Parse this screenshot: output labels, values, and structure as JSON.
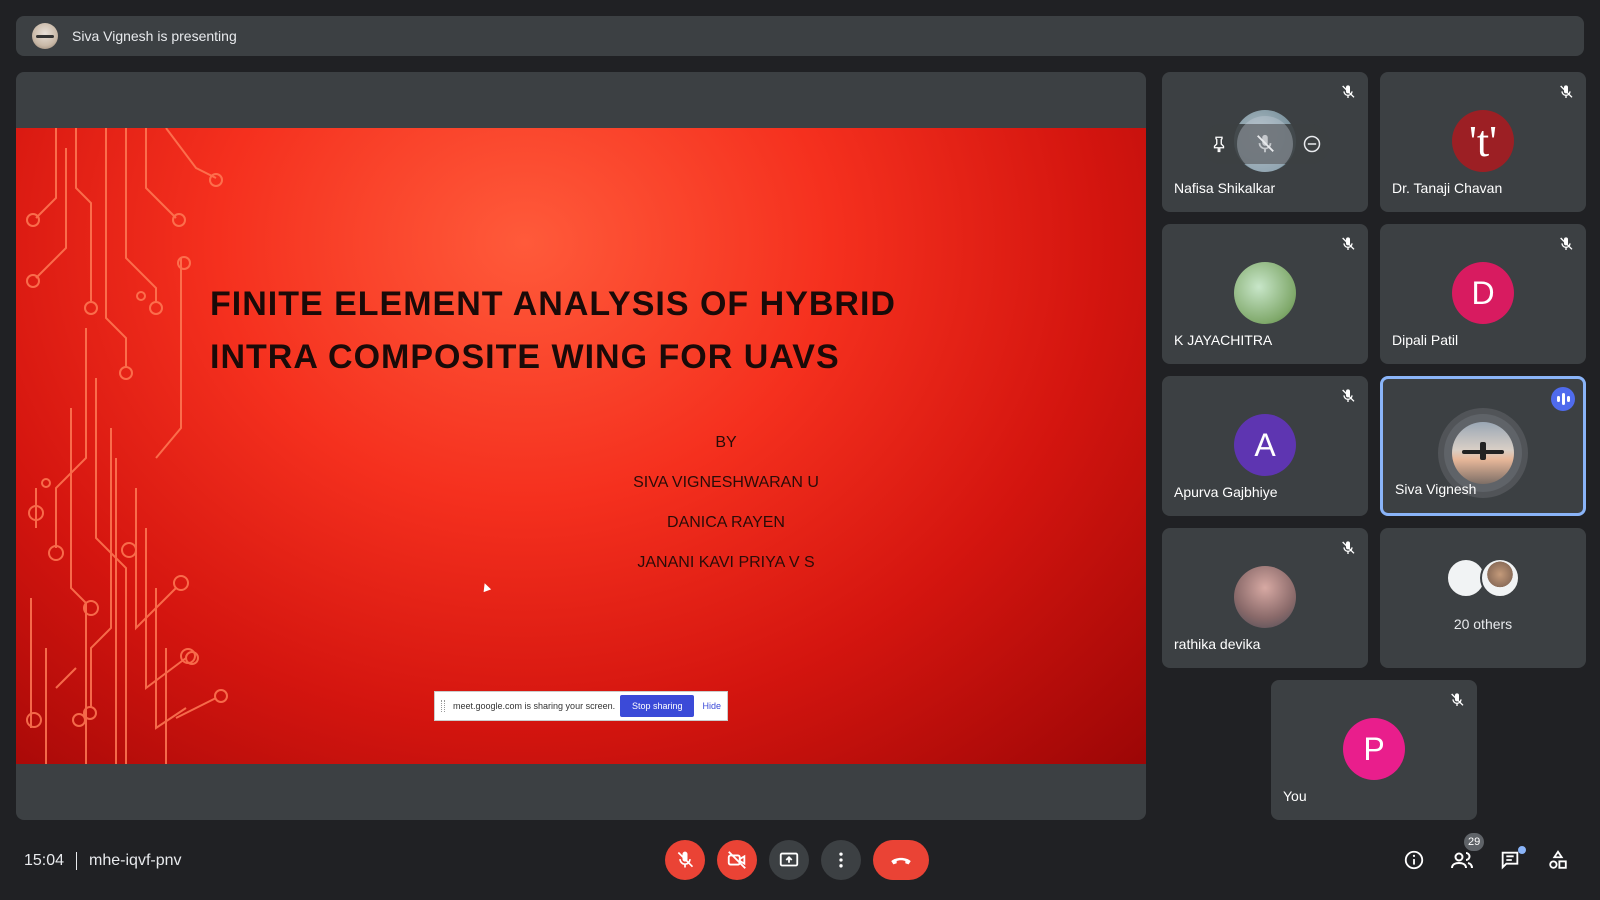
{
  "banner": {
    "presenter_text": "Siva Vignesh is presenting"
  },
  "slide": {
    "title_line1": "FINITE ELEMENT ANALYSIS OF HYBRID",
    "title_line2": "INTRA COMPOSITE WING FOR UAVS",
    "by": "BY",
    "authors": [
      "SIVA VIGNESHWARAN U",
      "DANICA RAYEN",
      "JANANI KAVI PRIYA V S"
    ],
    "share_notice": "meet.google.com is sharing your screen.",
    "stop_sharing": "Stop sharing",
    "hide": "Hide"
  },
  "participants": [
    {
      "name": "Nafisa Shikalkar",
      "avatar": "photo",
      "muted": true
    },
    {
      "name": "Dr. Tanaji Chavan",
      "initial": "'t'",
      "color": "#9c1f24",
      "muted": true
    },
    {
      "name": "K JAYACHITRA",
      "avatar": "photo",
      "muted": true
    },
    {
      "name": "Dipali Patil",
      "initial": "D",
      "color": "#d81b60",
      "muted": true
    },
    {
      "name": "Apurva Gajbhiye",
      "initial": "A",
      "color": "#5e35b1",
      "muted": true
    },
    {
      "name": "Siva Vignesh",
      "avatar": "photo",
      "speaking": true
    },
    {
      "name": "rathika devika",
      "avatar": "photo",
      "muted": true
    },
    {
      "name": "You",
      "initial": "P",
      "color": "#e91e8c",
      "muted": true
    }
  ],
  "others": {
    "label": "20 others"
  },
  "bottom": {
    "time": "15:04",
    "meeting_code": "mhe-iqvf-pnv",
    "people_count": "29"
  },
  "colors": {
    "accent": "#8ab4f8",
    "danger": "#ea4335",
    "surface": "#3c4043",
    "background": "#202124"
  }
}
